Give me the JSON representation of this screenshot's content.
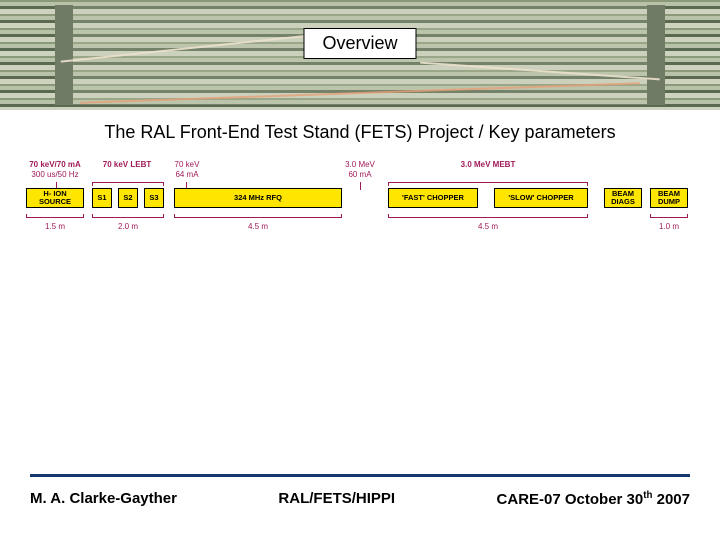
{
  "header": {
    "title": "Overview"
  },
  "subtitle": "The RAL Front-End Test Stand (FETS) Project / Key parameters",
  "segments": [
    {
      "top1": "70 keV/70 mA",
      "top2": "300 us/50 Hz"
    },
    {
      "top1": "70 keV LEBT",
      "top2": "",
      "bold": true
    },
    {
      "top1": "70 keV",
      "top2": "64 mA"
    },
    {
      "top1": "3.0 MeV",
      "top2": "60 mA"
    },
    {
      "top1": "3.0 MeV MEBT",
      "top2": "",
      "bold": true
    }
  ],
  "blocks": {
    "source": {
      "label": "H‑ ION\nSOURCE"
    },
    "s1": {
      "label": "S1"
    },
    "s2": {
      "label": "S2"
    },
    "s3": {
      "label": "S3"
    },
    "rfq": {
      "label": "324 MHz RFQ"
    },
    "fast": {
      "label": "'FAST' CHOPPER"
    },
    "slow": {
      "label": "'SLOW' CHOPPER"
    },
    "diags": {
      "label": "BEAM\nDIAGS"
    },
    "dump": {
      "label": "BEAM\nDUMP"
    }
  },
  "lengths": [
    "1.5 m",
    "2.0 m",
    "4.5 m",
    "4.5 m",
    "1.0 m"
  ],
  "footer": {
    "author": "M. A. Clarke-Gayther",
    "affiliation": "RAL/FETS/HIPPI",
    "event_prefix": "CARE-07 October 30",
    "event_suffix": "th",
    "event_year": " 2007"
  }
}
